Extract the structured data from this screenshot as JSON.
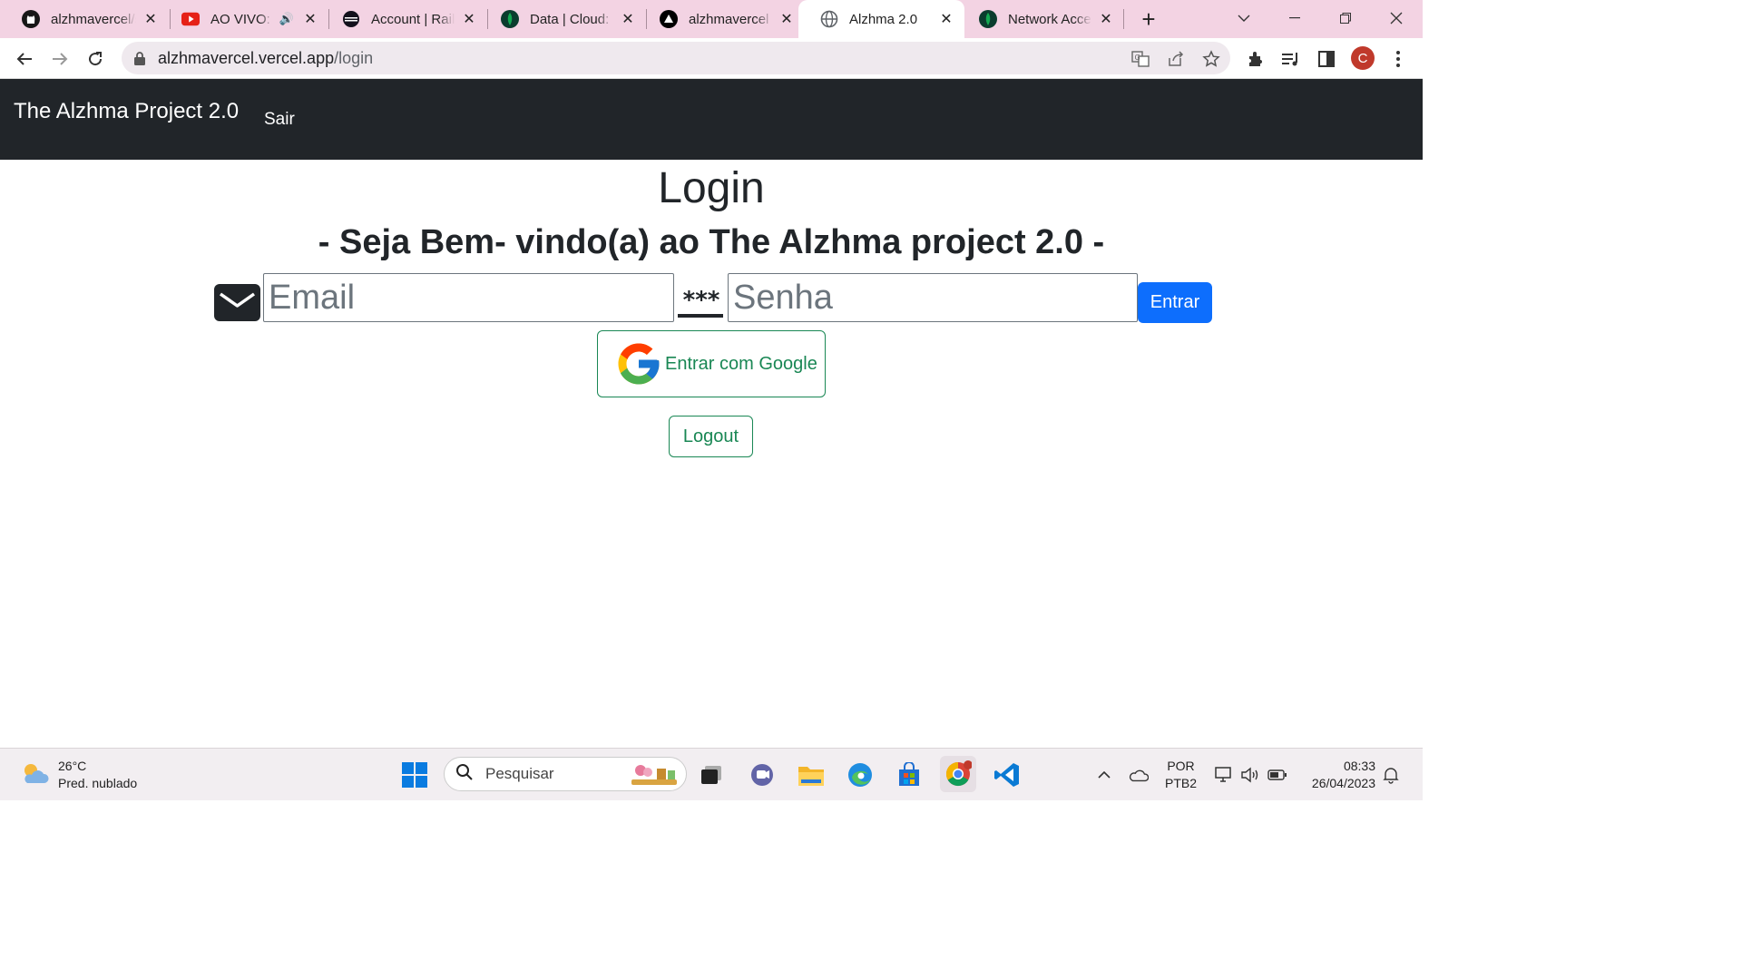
{
  "browser": {
    "tabs": [
      {
        "title": "alzhmavercel/sa",
        "icon": "github-icon"
      },
      {
        "title": "AO VIVO: C",
        "icon": "youtube-icon",
        "audio": true
      },
      {
        "title": "Account | Railw",
        "icon": "railway-icon"
      },
      {
        "title": "Data | Cloud: M",
        "icon": "mongodb-icon"
      },
      {
        "title": "alzhmavercel –",
        "icon": "vercel-icon"
      },
      {
        "title": "Alzhma 2.0",
        "icon": "globe-icon",
        "active": true
      },
      {
        "title": "Network Acces",
        "icon": "mongodb-icon"
      }
    ],
    "url_host": "alzhmavercel.vercel.app",
    "url_path": "/login",
    "profile_initial": "C",
    "accent": "#f3d3e3"
  },
  "page": {
    "navbar": {
      "brand": "The Alzhma Project 2.0",
      "link": "Sair"
    },
    "heading": "Login",
    "subheading": "- Seja Bem- vindo(a) ao The Alzhma project 2.0 -",
    "email": {
      "placeholder": "Email",
      "value": ""
    },
    "password": {
      "placeholder": "Senha",
      "value": "",
      "icon_text": "***"
    },
    "submit_label": "Entrar",
    "google_label": "Entrar com Google",
    "logout_label": "Logout",
    "colors": {
      "primary": "#0d6efd",
      "success": "#198754",
      "navbar": "#212529"
    }
  },
  "taskbar": {
    "weather_temp": "26°C",
    "weather_desc": "Pred. nublado",
    "search_placeholder": "Pesquisar",
    "lang_top": "POR",
    "lang_bottom": "PTB2",
    "time": "08:33",
    "date": "26/04/2023"
  }
}
